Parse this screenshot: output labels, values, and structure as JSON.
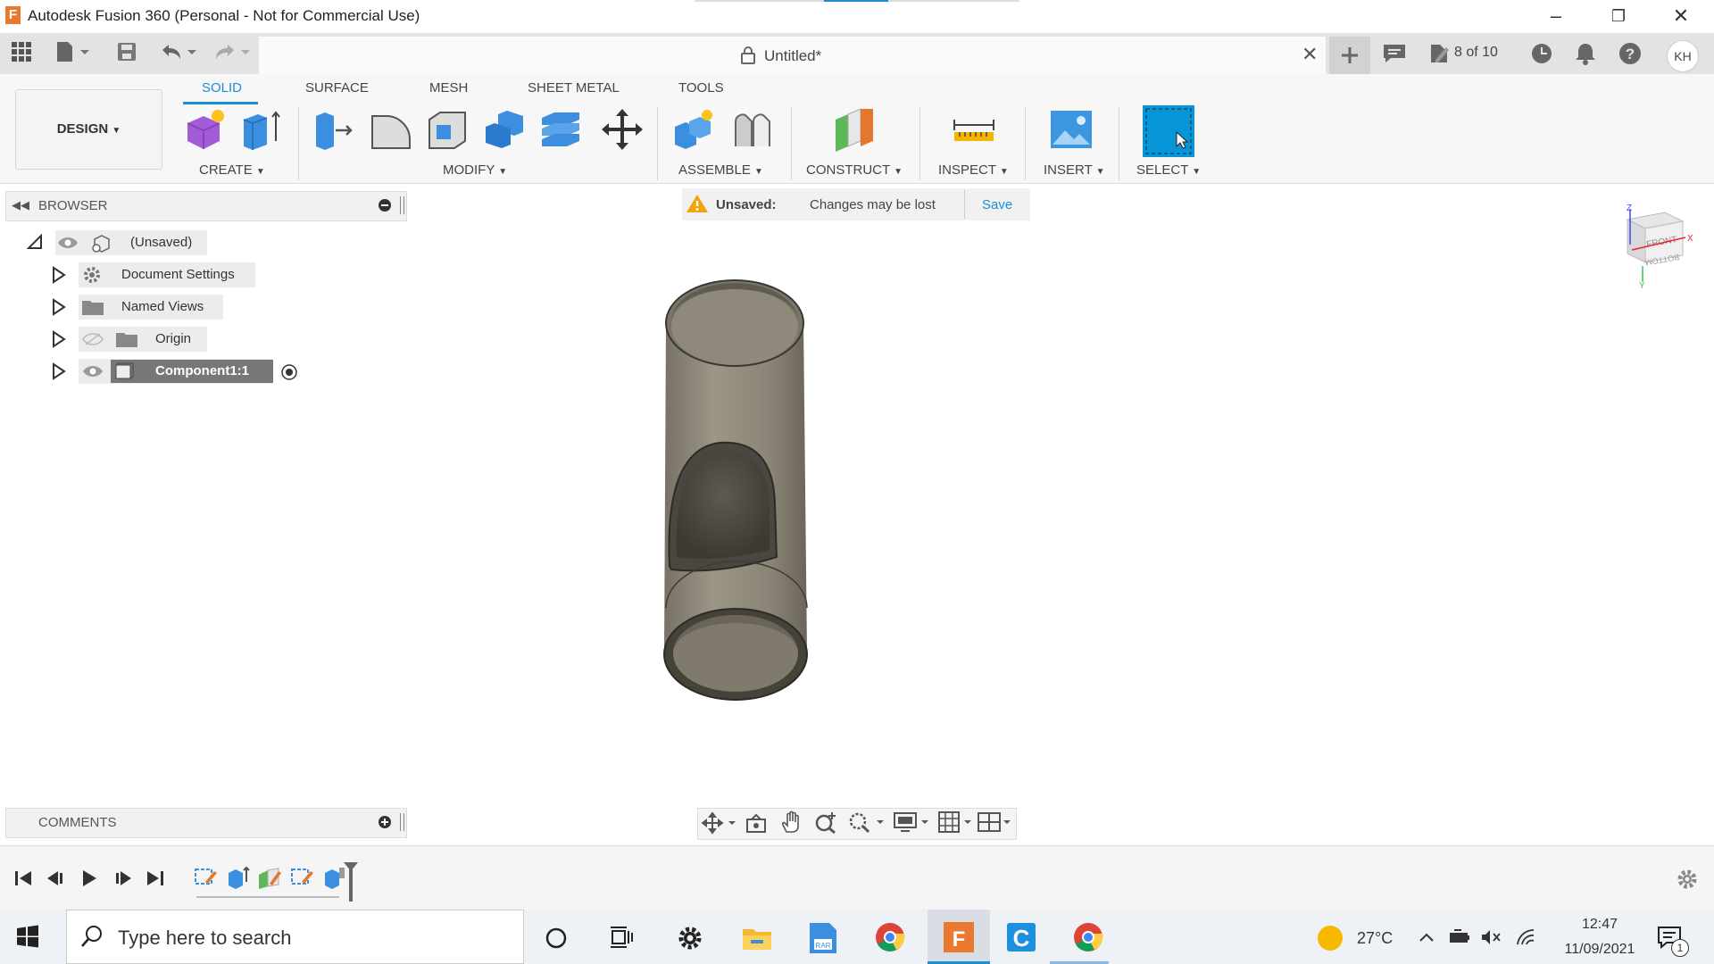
{
  "window": {
    "title": "Autodesk Fusion 360 (Personal - Not for Commercial Use)",
    "logo_letter": "F"
  },
  "top": {
    "document_title": "Untitled*",
    "jobs": "8 of 10",
    "user_initials": "KH"
  },
  "ribbon": {
    "workspace": "DESIGN",
    "tabs": [
      "SOLID",
      "SURFACE",
      "MESH",
      "SHEET METAL",
      "TOOLS"
    ],
    "groups": [
      "CREATE",
      "MODIFY",
      "ASSEMBLE",
      "CONSTRUCT",
      "INSPECT",
      "INSERT",
      "SELECT"
    ]
  },
  "browser": {
    "title": "BROWSER",
    "root": "(Unsaved)",
    "items": [
      "Document Settings",
      "Named Views",
      "Origin",
      "Component1:1"
    ]
  },
  "warning": {
    "label": "Unsaved:",
    "message": "Changes may be lost",
    "action": "Save"
  },
  "viewcube": {
    "front": "FRONT",
    "bottom": "BOTTOM"
  },
  "comments": {
    "title": "COMMENTS"
  },
  "taskbar": {
    "search_placeholder": "Type here to search",
    "weather": "27°C",
    "time": "12:47",
    "date": "11/09/2021",
    "notification_count": "1"
  },
  "colors": {
    "accent": "#1a8fd1",
    "select_tool": "#0696d7",
    "model_body": "#8a8476"
  }
}
